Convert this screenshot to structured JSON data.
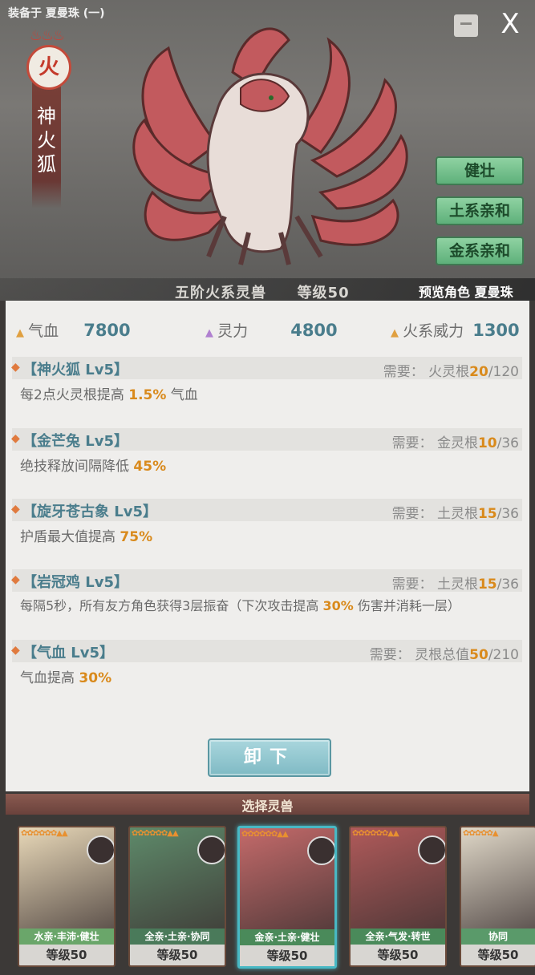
{
  "header": {
    "equipped_text": "装备于 夏曼珠 (一)",
    "close_label": "X"
  },
  "beast": {
    "element": "火",
    "name": "神火狐",
    "rank_text": "五阶火系灵兽",
    "level_text": "等级50",
    "preview_text": "预览角色 夏曼珠",
    "traits": [
      "健壮",
      "土系亲和",
      "金系亲和"
    ]
  },
  "stats": [
    {
      "label": "气血",
      "value": "7800",
      "color": "#e0a040"
    },
    {
      "label": "灵力",
      "value": "4800",
      "color": "#b080d0"
    },
    {
      "label": "火系威力",
      "value": "1300",
      "color": "#e0a040"
    }
  ],
  "skills": [
    {
      "title": "【神火狐 Lv5】",
      "req_label": "需要：",
      "req_name": "火灵根",
      "req_cur": "20",
      "req_max": "/120",
      "desc_pre": "每2点火灵根提高 ",
      "desc_hl": "1.5%",
      "desc_post": " 气血"
    },
    {
      "title": "【金芒兔 Lv5】",
      "req_label": "需要：",
      "req_name": "金灵根",
      "req_cur": "10",
      "req_max": "/36",
      "desc_pre": "绝技释放间隔降低 ",
      "desc_hl": "45%",
      "desc_post": ""
    },
    {
      "title": "【旋牙苍古象 Lv5】",
      "req_label": "需要：",
      "req_name": "土灵根",
      "req_cur": "15",
      "req_max": "/36",
      "desc_pre": "护盾最大值提高 ",
      "desc_hl": "75%",
      "desc_post": ""
    },
    {
      "title": "【岩冠鸡 Lv5】",
      "req_label": "需要：",
      "req_name": "土灵根",
      "req_cur": "15",
      "req_max": "/36",
      "desc_pre": "每隔5秒，所有友方角色获得3层振奋（下次攻击提高 ",
      "desc_hl": "30%",
      "desc_post": " 伤害并消耗一层）"
    },
    {
      "title": "【气血 Lv5】",
      "req_label": "需要：",
      "req_name": "灵根总值",
      "req_cur": "50",
      "req_max": "/210",
      "desc_pre": "气血提高 ",
      "desc_hl": "30%",
      "desc_post": ""
    }
  ],
  "unequip_label": "卸下",
  "select_label": "选择灵兽",
  "cards": [
    {
      "tags": "水亲·丰沛·健壮",
      "level": "等级50",
      "bg": "#e8d8b8",
      "tag_bg": "#6aa66a"
    },
    {
      "tags": "全亲·土亲·协同",
      "level": "等级50",
      "bg": "#5e8a6a",
      "tag_bg": "#4a7a5a"
    },
    {
      "tags": "金亲·土亲·健壮",
      "level": "等级50",
      "bg": "#c46a6a",
      "tag_bg": "#4a8a5a"
    },
    {
      "tags": "全亲·气发·转世",
      "level": "等级50",
      "bg": "#b05a5a",
      "tag_bg": "#4a8a5a"
    },
    {
      "tags": "协同",
      "level": "等级50",
      "bg": "#e0d8c8",
      "tag_bg": "#5a9a6a"
    }
  ]
}
